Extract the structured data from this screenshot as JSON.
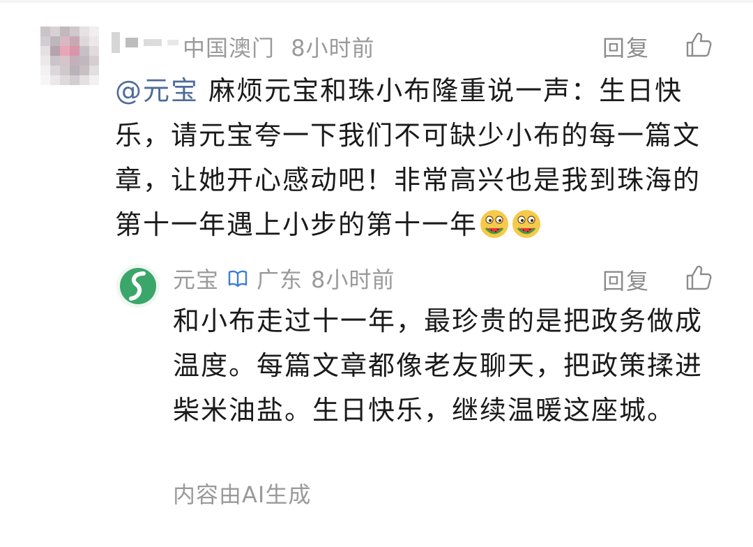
{
  "comment": {
    "location": "中国澳门",
    "time": "8小时前",
    "reply_label": "回复",
    "mention": "@元宝",
    "text": "麻烦元宝和珠小布隆重说一声：生日快乐，请元宝夸一下我们不可缺少小布的每一篇文章，让她开心感动吧！非常高兴也是我到珠海的第十一年遇上小步的第十一年",
    "emojis": [
      "eating-watermelon-emoji",
      "eating-watermelon-emoji"
    ]
  },
  "reply": {
    "name": "元宝",
    "location": "广东",
    "time": "8小时前",
    "reply_label": "回复",
    "text": "和小布走过十一年，最珍贵的是把政务做成温度。每篇文章都像老友聊天，把政策揉进柴米油盐。生日快乐，继续温暖这座城。",
    "ai_note": "内容由AI生成"
  },
  "colors": {
    "mention": "#4d6c99",
    "meta_gray": "#9a9a9a",
    "avatar_green": "#3aa66a"
  }
}
